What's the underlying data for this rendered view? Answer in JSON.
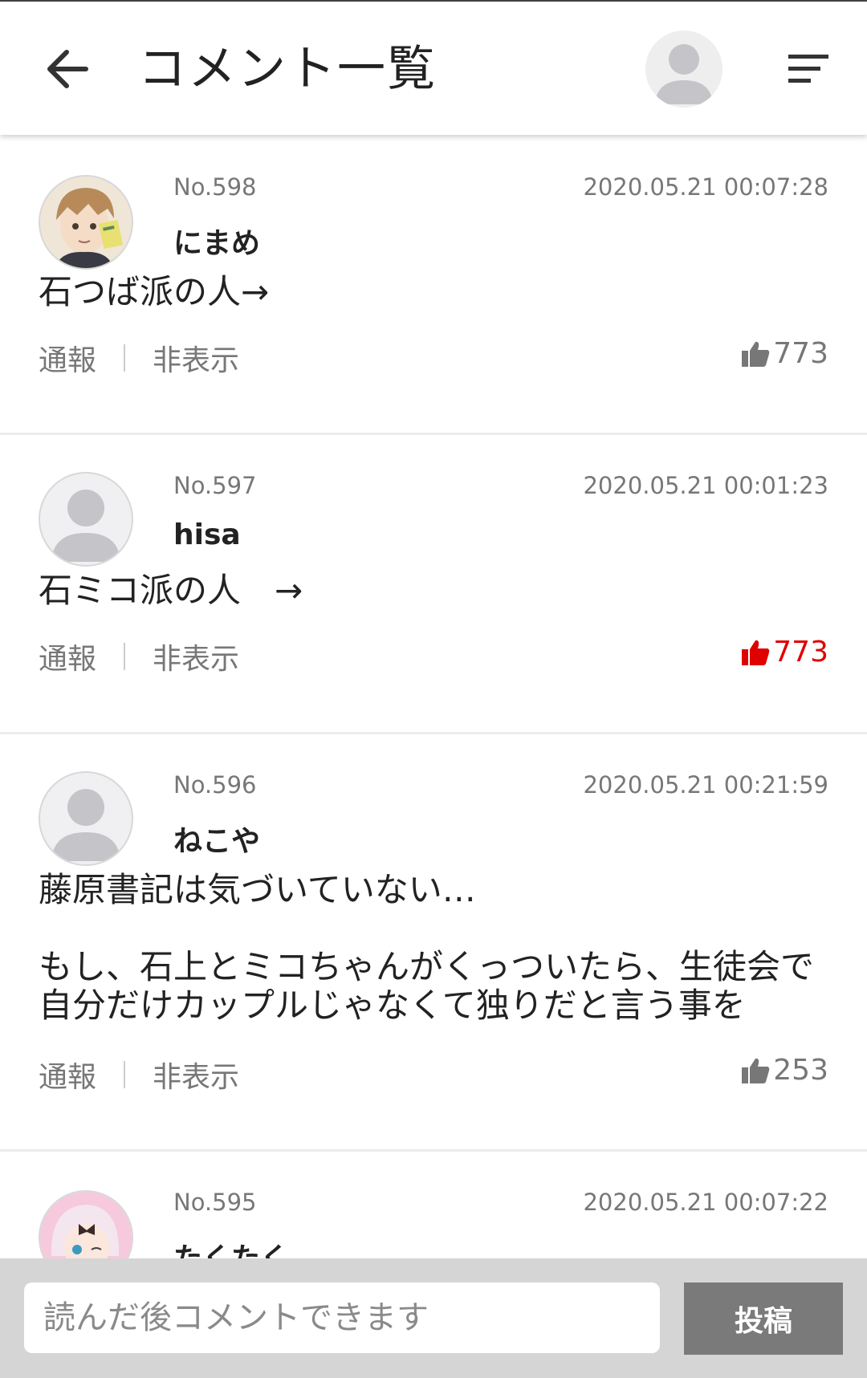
{
  "header": {
    "title": "コメント一覧"
  },
  "comments": [
    {
      "number": "No.598",
      "date": "2020.05.21 00:07:28",
      "user": "にまめ",
      "avatar": "illustrated-boy-avatar",
      "text": "石つば派の人→",
      "report": "通報",
      "hide": "非表示",
      "likes": "773",
      "liked": false
    },
    {
      "number": "No.597",
      "date": "2020.05.21 00:01:23",
      "user": "hisa",
      "avatar": "default-user-avatar",
      "text": "石ミコ派の人　→",
      "report": "通報",
      "hide": "非表示",
      "likes": "773",
      "liked": true
    },
    {
      "number": "No.596",
      "date": "2020.05.21 00:21:59",
      "user": "ねこや",
      "avatar": "default-user-avatar",
      "text": "藤原書記は気づいていない…\n\nもし、石上とミコちゃんがくっついたら、生徒会で自分だけカップルじゃなくて独りだと言う事を",
      "report": "通報",
      "hide": "非表示",
      "likes": "253",
      "liked": false
    },
    {
      "number": "No.595",
      "date": "2020.05.21 00:07:22",
      "user": "たくたく",
      "avatar": "illustrated-girl-avatar"
    }
  ],
  "composer": {
    "placeholder": "読んだ後コメントできます",
    "post_label": "投稿"
  },
  "colors": {
    "liked": "#e00000",
    "muted": "#777777",
    "post_button": "#7a7a7a"
  }
}
